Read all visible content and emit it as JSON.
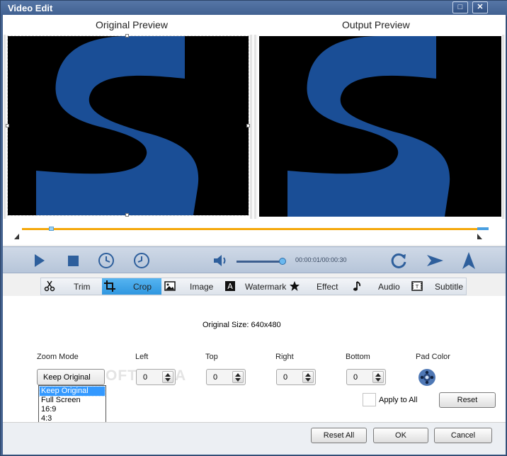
{
  "window": {
    "title": "Video Edit",
    "minimize_glyph": "□",
    "close_glyph": "✕"
  },
  "preview": {
    "original_title": "Original Preview",
    "output_title": "Output Preview"
  },
  "player": {
    "time_readout": "00:00:01/00:00:30",
    "volume_level": 0.95,
    "buttons": [
      "play-icon",
      "stop-icon",
      "start-time-icon",
      "end-time-icon",
      "volume-icon",
      "rotate-icon",
      "flip-horizontal-icon",
      "flip-vertical-icon"
    ]
  },
  "tabs": [
    {
      "label": "Trim",
      "icon": "scissors-icon"
    },
    {
      "label": "Crop",
      "icon": "crop-icon",
      "active": true
    },
    {
      "label": "Image",
      "icon": "image-icon"
    },
    {
      "label": "Watermark",
      "icon": "watermark-icon"
    },
    {
      "label": "Effect",
      "icon": "star-icon"
    },
    {
      "label": "Audio",
      "icon": "music-note-icon"
    },
    {
      "label": "Subtitle",
      "icon": "subtitle-icon"
    }
  ],
  "crop": {
    "original_size": "Original Size: 640x480",
    "zoom_mode_label": "Zoom Mode",
    "zoom_mode_value": "Keep Original",
    "zoom_options": [
      "Keep Original",
      "Full Screen",
      "16:9",
      "4:3"
    ],
    "left_label": "Left",
    "left_value": "0",
    "top_label": "Top",
    "top_value": "0",
    "right_label": "Right",
    "right_value": "0",
    "bottom_label": "Bottom",
    "bottom_value": "0",
    "pad_color_label": "Pad Color",
    "apply_to_all_label": "Apply to All",
    "reset_label": "Reset",
    "watermark_text": "OFTPEDIA"
  },
  "footer": {
    "reset_all_label": "Reset All",
    "ok_label": "OK",
    "cancel_label": "Cancel"
  },
  "colors": {
    "video_logo": "#1a4e96",
    "accent": "#2f97e0",
    "timeline": "#f5a80a"
  }
}
